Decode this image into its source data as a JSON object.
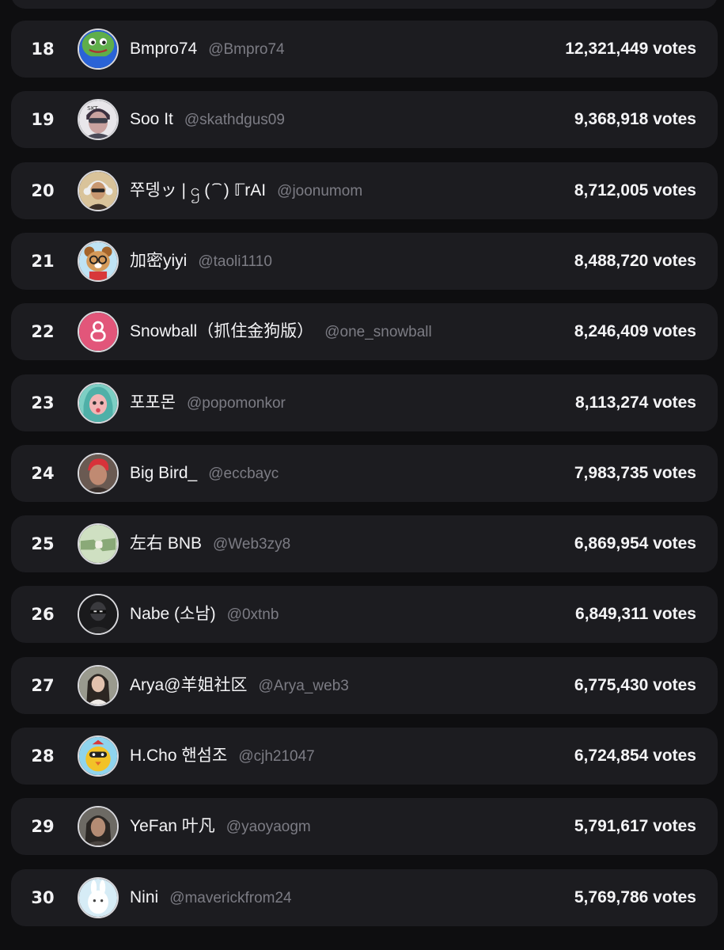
{
  "leaderboard": {
    "rows": [
      {
        "rank": "18",
        "name": "Bmpro74",
        "handle": "@Bmpro74",
        "votes": "12,321,449 votes",
        "avatar": "frog-avatar-icon",
        "colors": [
          "#5fae4a",
          "#2a63d6"
        ]
      },
      {
        "rank": "19",
        "name": "Soo It",
        "handle": "@skathdgus09",
        "votes": "9,368,918 votes",
        "avatar": "sunglasses-man-avatar-icon",
        "colors": [
          "#e8e6ea",
          "#3a3c48"
        ]
      },
      {
        "rank": "20",
        "name": "쭈뎅ッ | ဌ ( ᷇ ᷆ ) ℾrAI",
        "handle": "@joonumom",
        "votes": "8,712,005 votes",
        "avatar": "headphones-man-avatar-icon",
        "colors": [
          "#d9c39a",
          "#3b3027"
        ]
      },
      {
        "rank": "21",
        "name": "加密yiyi",
        "handle": "@taoli1110",
        "votes": "8,488,720 votes",
        "avatar": "bear-glasses-avatar-icon",
        "colors": [
          "#bfe3f4",
          "#a5652b"
        ]
      },
      {
        "rank": "22",
        "name": "Snowball（抓住金狗版）",
        "handle": "@one_snowball",
        "votes": "8,246,409 votes",
        "avatar": "snowball-logo-icon",
        "colors": [
          "#e2567a",
          "#ffffff"
        ]
      },
      {
        "rank": "23",
        "name": "포포몬",
        "handle": "@popomonkor",
        "votes": "8,113,274 votes",
        "avatar": "anime-girl-avatar-icon",
        "colors": [
          "#7dcfc4",
          "#f2b5b5"
        ]
      },
      {
        "rank": "24",
        "name": "Big Bird_",
        "handle": "@eccbayc",
        "votes": "7,983,735 votes",
        "avatar": "red-hair-man-avatar-icon",
        "colors": [
          "#6a5a52",
          "#d8323a"
        ]
      },
      {
        "rank": "25",
        "name": "左右 BNB",
        "handle": "@Web3zy8",
        "votes": "6,869,954 votes",
        "avatar": "handshake-avatar-icon",
        "colors": [
          "#cfe0c2",
          "#8aa978"
        ]
      },
      {
        "rank": "26",
        "name": "Nabe (소남)",
        "handle": "@0xtnb",
        "votes": "6,849,311 votes",
        "avatar": "masked-man-avatar-icon",
        "colors": [
          "#1a1a1c",
          "#3a3a3e"
        ]
      },
      {
        "rank": "27",
        "name": "Arya@羊姐社区",
        "handle": "@Arya_web3",
        "votes": "6,775,430 votes",
        "avatar": "woman-photo-avatar-icon",
        "colors": [
          "#9a9a8e",
          "#2c2622"
        ]
      },
      {
        "rank": "28",
        "name": "H.Cho 핸섬조",
        "handle": "@cjh21047",
        "votes": "6,724,854 votes",
        "avatar": "yellow-bird-avatar-icon",
        "colors": [
          "#8fd4ee",
          "#f2c228"
        ]
      },
      {
        "rank": "29",
        "name": "YeFan 叶凡",
        "handle": "@yaoyaogm",
        "votes": "5,791,617 votes",
        "avatar": "warrior-avatar-icon",
        "colors": [
          "#6d6a64",
          "#2b2724"
        ]
      },
      {
        "rank": "30",
        "name": "Nini",
        "handle": "@maverickfrom24",
        "votes": "5,769,786 votes",
        "avatar": "white-bunny-avatar-icon",
        "colors": [
          "#d6ecf6",
          "#ffffff"
        ]
      }
    ]
  }
}
